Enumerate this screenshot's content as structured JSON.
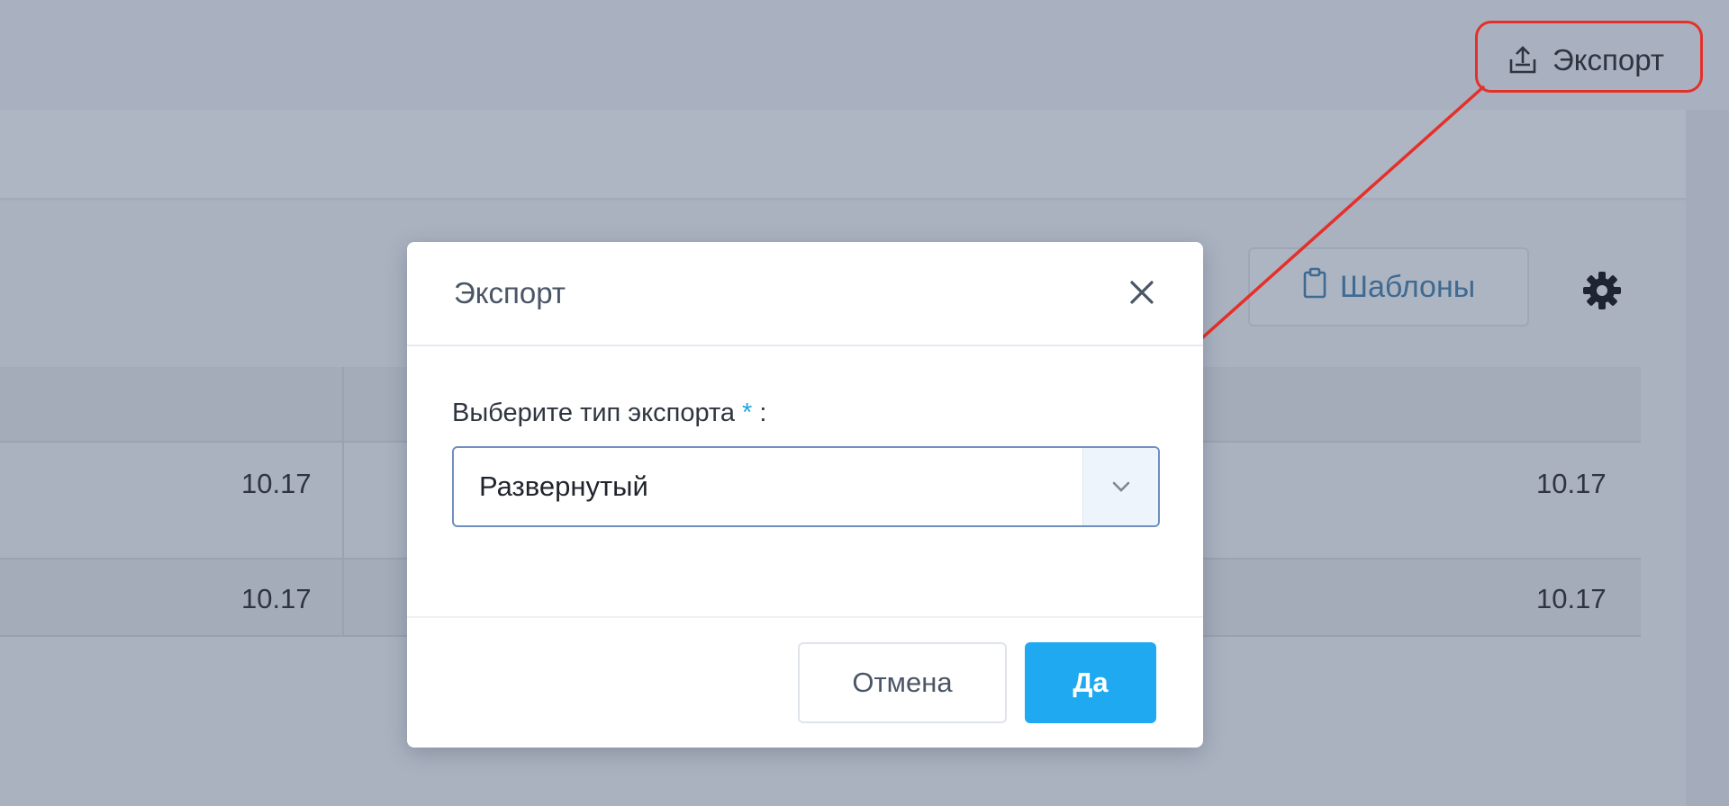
{
  "header": {
    "export_label": "Экспорт",
    "export_icon": "upload-icon"
  },
  "toolbar": {
    "templates_label": "Шаблоны",
    "templates_icon": "clipboard-icon",
    "settings_icon": "gear-icon"
  },
  "table": {
    "rows": [
      {
        "left_value": "10.17",
        "right_value": "10.17"
      },
      {
        "left_value": "10.17",
        "right_value": "10.17"
      }
    ]
  },
  "modal": {
    "title": "Экспорт",
    "close_icon": "close-icon",
    "field_label": "Выберите тип экспорта",
    "required_mark": "*",
    "label_suffix": ":",
    "select_value": "Развернутый",
    "select_icon": "chevron-down-icon",
    "cancel_label": "Отмена",
    "ok_label": "Да"
  },
  "colors": {
    "accent": "#1fa9f0",
    "highlight": "#e5302a",
    "overlay": "#a8b0bf"
  }
}
